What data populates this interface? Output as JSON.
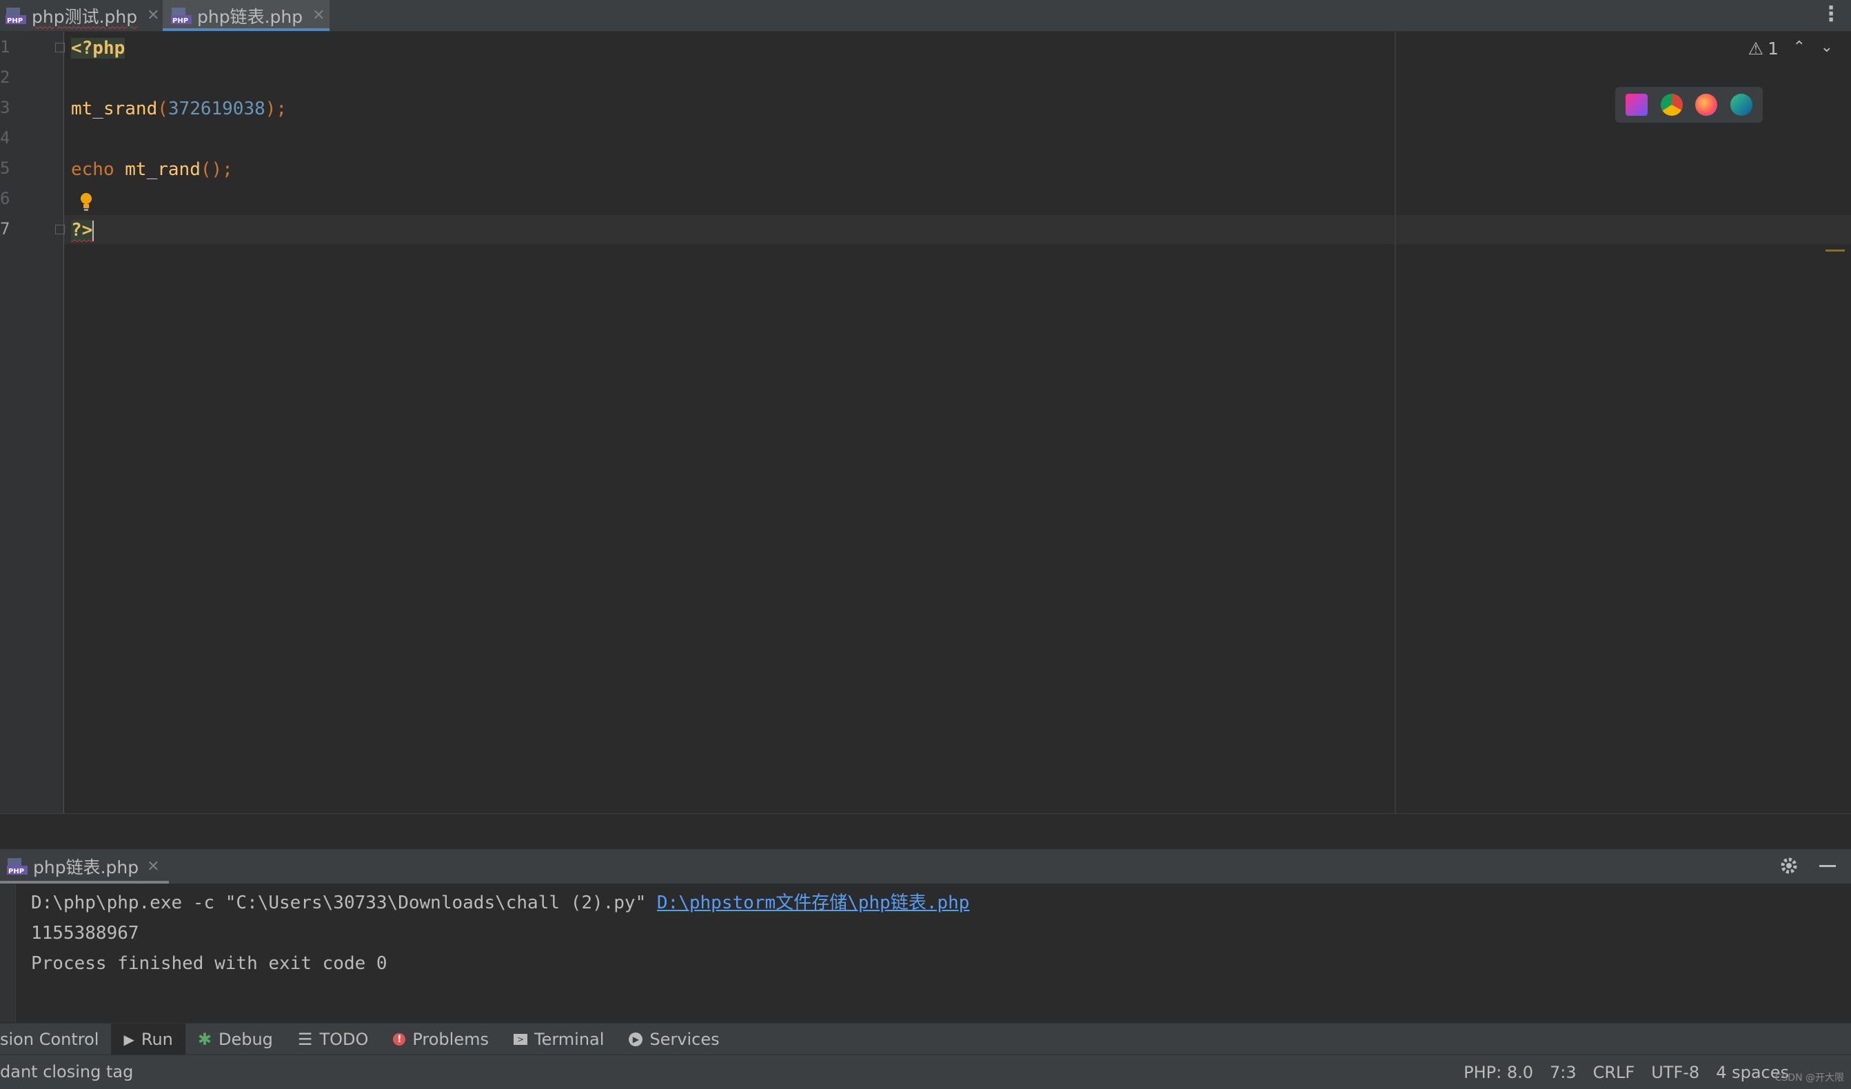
{
  "tabs": [
    {
      "label": "php测试.php",
      "active": false,
      "icon": "php-file-icon",
      "has_error": true
    },
    {
      "label": "php链表.php",
      "active": true,
      "icon": "php-file-icon",
      "has_error": false
    }
  ],
  "editor": {
    "line_numbers": [
      "1",
      "2",
      "3",
      "4",
      "5",
      "6",
      "7"
    ],
    "lines": {
      "l1_open_tag": "<?php",
      "l3_fn": "mt_srand",
      "l3_paren_open": "(",
      "l3_num": "372619038",
      "l3_tail": ");",
      "l5_kw": "echo",
      "l5_fn": "mt_rand",
      "l5_tail": "();",
      "l7_close_tag": "?>"
    },
    "warnings_count": "1",
    "caret_position": "7:3"
  },
  "browser_icons": [
    "phpstorm-icon",
    "chrome-icon",
    "firefox-icon",
    "edge-icon"
  ],
  "run": {
    "tab_label": "php链表.php",
    "command_text": "D:\\php\\php.exe -c \"C:\\Users\\30733\\Downloads\\chall (2).py\" ",
    "command_link": "D:\\phpstorm文件存储\\php链表.php",
    "output": "1155388967",
    "exit_message": "Process finished with exit code 0"
  },
  "tool_windows": [
    {
      "label": "sion Control",
      "icon": ""
    },
    {
      "label": "Run",
      "icon": "play-icon"
    },
    {
      "label": "Debug",
      "icon": "bug-icon"
    },
    {
      "label": "TODO",
      "icon": "list-icon"
    },
    {
      "label": "Problems",
      "icon": "error-icon"
    },
    {
      "label": "Terminal",
      "icon": "terminal-icon"
    },
    {
      "label": "Services",
      "icon": "services-icon"
    }
  ],
  "status": {
    "message": "dant closing tag",
    "php_version": "PHP: 8.0",
    "position": "7:3",
    "line_separator": "CRLF",
    "encoding": "UTF-8",
    "indent": "4 spaces",
    "watermark": "CSDN @开大限"
  },
  "colors": {
    "keyword": "#cc7832",
    "function": "#ffc66d",
    "number": "#6897bb",
    "tag": "#e8bf6a",
    "link": "#589df6",
    "background": "#2b2b2b"
  }
}
